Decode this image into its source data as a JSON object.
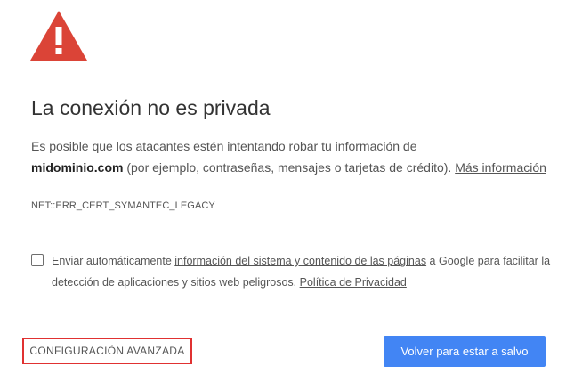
{
  "error_page": {
    "icon": "warning-triangle-icon",
    "icon_color": "#db4437",
    "title": "La conexión no es privada",
    "message": {
      "line1": "Es posible que los atacantes estén intentando robar tu información de",
      "domain": "midominio.com",
      "rest": " (por ejemplo, contraseñas, mensajes o tarjetas de crédito). ",
      "more_link": "Más información"
    },
    "error_code": "NET::ERR_CERT_SYMANTEC_LEGACY",
    "optin": {
      "checked": false,
      "prefix": "Enviar automáticamente ",
      "link1": "información del sistema y contenido de las páginas",
      "middle": " a Google para facilitar la detección de aplicaciones y sitios web peligrosos. ",
      "link2": "Política de Privacidad"
    },
    "advanced_button": "CONFIGURACIÓN AVANZADA",
    "back_button": "Volver para estar a salvo",
    "accent_color": "#4285f4",
    "highlight_color": "#e03131"
  }
}
